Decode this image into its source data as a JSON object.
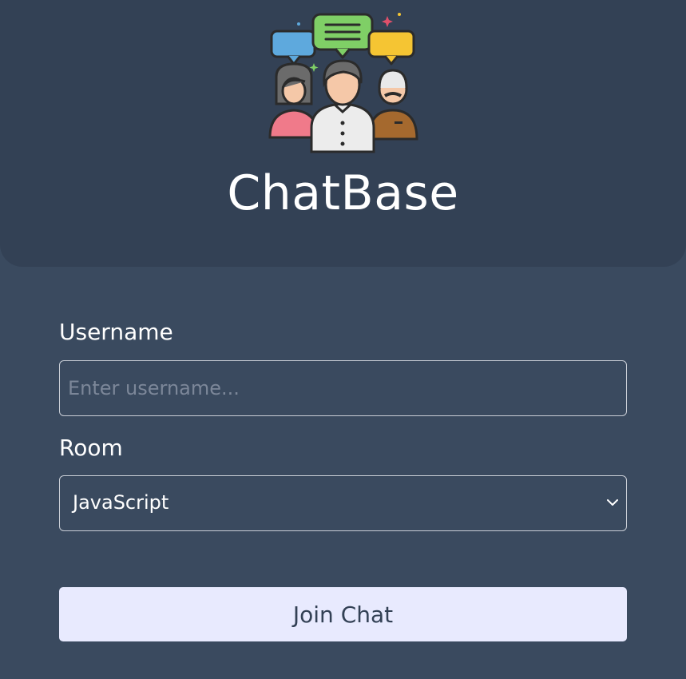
{
  "header": {
    "logo_icon": "group-chat-people-icon",
    "title": "ChatBase"
  },
  "form": {
    "username_label": "Username",
    "username_placeholder": "Enter username...",
    "username_value": "",
    "room_label": "Room",
    "room_selected": "JavaScript",
    "submit_label": "Join Chat"
  },
  "colors": {
    "page_background": "#3a4a5f",
    "header_background": "#334155",
    "button_background": "#e8eafe",
    "button_text": "#334155"
  }
}
